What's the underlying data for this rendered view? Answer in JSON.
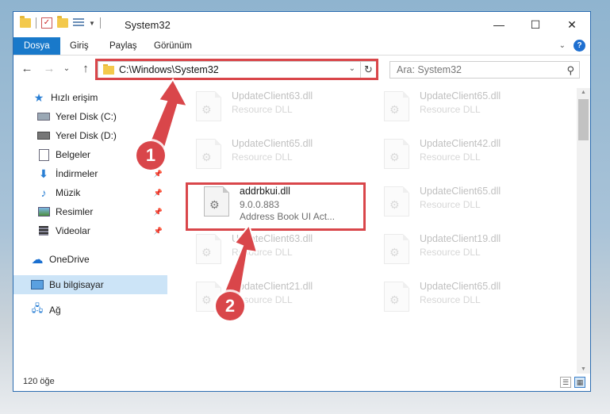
{
  "window": {
    "title": "System32",
    "minimize_glyph": "—",
    "maximize_glyph": "☐",
    "close_glyph": "✕"
  },
  "ribbon": {
    "tabs": [
      {
        "label": "Dosya"
      },
      {
        "label": "Giriş"
      },
      {
        "label": "Paylaş"
      },
      {
        "label": "Görünüm"
      }
    ],
    "help_glyph": "?",
    "collapse_glyph": "⌄"
  },
  "navigation": {
    "back_glyph": "←",
    "forward_glyph": "→",
    "recent_glyph": "⌄",
    "up_glyph": "↑",
    "address": "C:\\Windows\\System32",
    "dropdown_glyph": "⌄",
    "refresh_glyph": "↻",
    "search_placeholder": "Ara: System32",
    "search_glyph": "⚲"
  },
  "sidebar": {
    "quick_access": {
      "label": "Hızlı erişim",
      "icon": "star-icon"
    },
    "items": [
      {
        "label": "Yerel Disk (C:)",
        "icon": "drive-icon",
        "pinned": false
      },
      {
        "label": "Yerel Disk (D:)",
        "icon": "drive-icon",
        "pinned": false
      },
      {
        "label": "Belgeler",
        "icon": "documents-icon",
        "pinned": true
      },
      {
        "label": "İndirmeler",
        "icon": "download-icon",
        "pinned": true
      },
      {
        "label": "Müzik",
        "icon": "music-icon",
        "pinned": true
      },
      {
        "label": "Resimler",
        "icon": "pictures-icon",
        "pinned": true
      },
      {
        "label": "Videolar",
        "icon": "video-icon",
        "pinned": true
      }
    ],
    "onedrive": {
      "label": "OneDrive",
      "icon": "cloud-icon"
    },
    "this_pc": {
      "label": "Bu bilgisayar",
      "icon": "computer-icon",
      "selected": true
    },
    "network": {
      "label": "Ağ",
      "icon": "network-icon"
    }
  },
  "files": [
    {
      "name": "UpdateClient63.dll",
      "line2": "Resource DLL",
      "line3": "",
      "faded": true
    },
    {
      "name": "UpdateClient65.dll",
      "line2": "Resource DLL",
      "line3": "",
      "faded": true
    },
    {
      "name": "UpdateClient65.dll",
      "line2": "Resource DLL",
      "line3": "",
      "faded": true
    },
    {
      "name": "UpdateClient42.dll",
      "line2": "Resource DLL",
      "line3": "",
      "faded": true
    },
    {
      "name": "addrbkui.dll",
      "line2": "9.0.0.883",
      "line3": "Address Book UI Act...",
      "faded": false
    },
    {
      "name": "UpdateClient65.dll",
      "line2": "Resource DLL",
      "line3": "",
      "faded": true
    },
    {
      "name": "UpdateClient63.dll",
      "line2": "Resource DLL",
      "line3": "",
      "faded": true
    },
    {
      "name": "UpdateClient19.dll",
      "line2": "Resource DLL",
      "line3": "",
      "faded": true
    },
    {
      "name": "UpdateClient21.dll",
      "line2": "Resource DLL",
      "line3": "",
      "faded": true
    },
    {
      "name": "UpdateClient65.dll",
      "line2": "Resource DLL",
      "line3": "",
      "faded": true
    }
  ],
  "status": {
    "item_count": "120 öğe"
  },
  "annotations": {
    "step1": "1",
    "step2": "2",
    "highlight_color": "#d9464a"
  }
}
